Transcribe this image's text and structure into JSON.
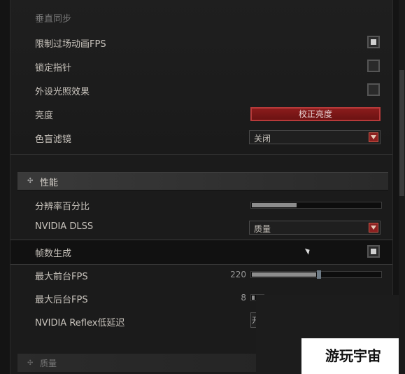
{
  "display": {
    "vsync_label": "垂直同步",
    "cutscene_fps_label": "限制过场动画FPS",
    "cutscene_fps_checked": true,
    "lock_cursor_label": "锁定指针",
    "lock_cursor_checked": false,
    "peripheral_light_label": "外设光照效果",
    "peripheral_light_checked": false,
    "brightness_label": "亮度",
    "brightness_button": "校正亮度",
    "colorblind_label": "色盲滤镜",
    "colorblind_value": "关闭"
  },
  "performance": {
    "section_title": "性能",
    "resolution_label": "分辨率百分比",
    "resolution_fill_fraction": 0.35,
    "dlss_label": "NVIDIA DLSS",
    "dlss_value": "质量",
    "frame_gen_label": "帧数生成",
    "frame_gen_checked": true,
    "max_fg_fps_label": "最大前台FPS",
    "max_fg_fps_value": "220",
    "max_bg_fps_label": "最大后台FPS",
    "max_bg_fps_value": "8",
    "reflex_label": "NVIDIA Reflex低延迟",
    "reflex_value_partial": "开"
  },
  "quality": {
    "section_title": "质量"
  },
  "watermark": "游玩宇宙",
  "colors": {
    "accent_red": "#8a1c1c",
    "panel_bg": "#1b1b1b"
  }
}
